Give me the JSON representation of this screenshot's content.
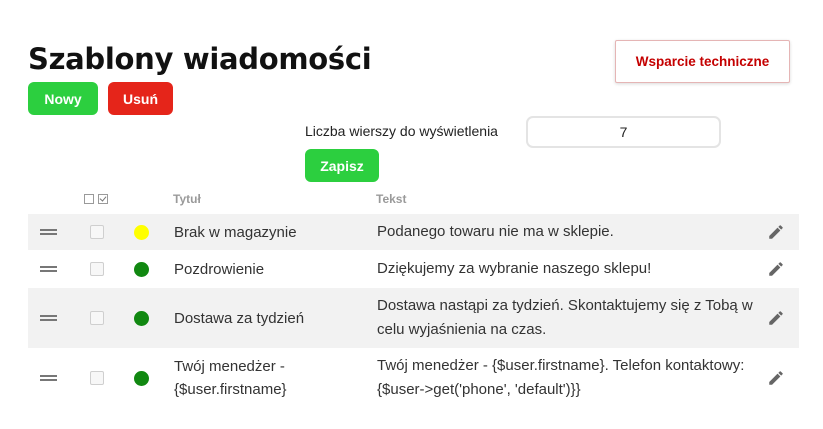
{
  "header": {
    "title": "Szablony wiadomości",
    "support_label": "Wsparcie techniczne"
  },
  "toolbar": {
    "new_label": "Nowy",
    "delete_label": "Usuń"
  },
  "settings": {
    "rows_label": "Liczba wierszy do wyświetlenia",
    "rows_value": "7",
    "save_label": "Zapisz"
  },
  "table": {
    "headers": {
      "title": "Tytuł",
      "text": "Tekst"
    },
    "rows": [
      {
        "title": "Brak w magazynie",
        "text": "Podanego towaru nie ma w sklepie.",
        "status_color": "#ffff00"
      },
      {
        "title": "Pozdrowienie",
        "text": "Dziękujemy za wybranie naszego sklepu!",
        "status_color": "#118811"
      },
      {
        "title": "Dostawa za tydzień",
        "text": "Dostawa nastąpi za tydzień. Skontaktujemy się z Tobą w celu wyjaśnienia na czas.",
        "status_color": "#118811"
      },
      {
        "title": "Twój menedżer - {$user.firstname}",
        "text": "Twój menedżer - {$user.firstname}. Telefon kontaktowy: {$user->get('phone', 'default')}}",
        "status_color": "#118811"
      }
    ]
  },
  "colors": {
    "accent_green": "#2ccf3f",
    "danger_red": "#e5251a",
    "support_red": "#c40000"
  },
  "icons": {
    "drag": "drag-handle-icon",
    "edit": "pencil-icon",
    "select_none": "checkbox-empty-icon",
    "select_all": "checkbox-checked-icon"
  }
}
